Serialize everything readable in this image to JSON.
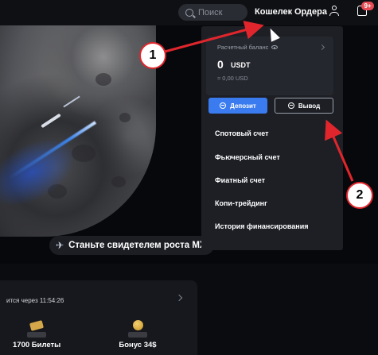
{
  "topbar": {
    "search_placeholder": "Поиск",
    "wallet_label": "Кошелек",
    "orders_label": "Ордера",
    "notification_badge": "9+"
  },
  "hero": {
    "cta_label": "Станьте свидетелем роста MX"
  },
  "bottom_card": {
    "timer_text": "ится через 11:54:26",
    "prizes": [
      {
        "label": "1700 Билеты",
        "icon": "ticket-icon"
      },
      {
        "label": "Бонус 34$",
        "icon": "coin-icon"
      }
    ]
  },
  "wallet_panel": {
    "balance_label": "Расчетный баланс",
    "balance_amount": "0",
    "balance_currency": "USDT",
    "balance_usd": "≈ 0,00 USD",
    "deposit_label": "Депозит",
    "withdraw_label": "Вывод",
    "menu": [
      {
        "label": "Спотовый счет"
      },
      {
        "label": "Фьючерсный счет"
      },
      {
        "label": "Фиатный счет"
      },
      {
        "label": "Копи-трейдинг"
      },
      {
        "label": "История финансирования"
      }
    ]
  },
  "annotations": {
    "marker_1": "1",
    "marker_2": "2",
    "color": "#e0262c"
  },
  "colors": {
    "accent_blue": "#3a7bf0",
    "panel_bg": "#1d1f25",
    "badge_red": "#e84c55"
  }
}
